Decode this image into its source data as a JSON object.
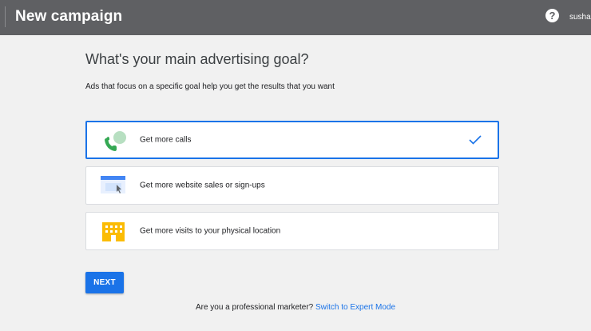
{
  "header": {
    "title": "New campaign",
    "help_icon": "help-circle-icon",
    "help_glyph": "?",
    "user": "sushar"
  },
  "main": {
    "heading": "What's your main advertising goal?",
    "subheading": "Ads that focus on a specific goal help you get the results that you want",
    "goals": [
      {
        "label": "Get more calls",
        "icon": "phone-call-icon",
        "selected": true
      },
      {
        "label": "Get more website sales or sign-ups",
        "icon": "website-icon",
        "selected": false
      },
      {
        "label": "Get more visits to your physical location",
        "icon": "storefront-icon",
        "selected": false
      }
    ],
    "selected_icon": "checkmark-icon",
    "next_label": "NEXT"
  },
  "footer": {
    "prompt": "Are you a professional marketer?",
    "link": "Switch to Expert Mode"
  },
  "colors": {
    "header_bg": "#5f6063",
    "page_bg": "#f1f1f1",
    "accent": "#1a73e8",
    "phone_green": "#34a853",
    "store_yellow": "#fbbc04"
  }
}
